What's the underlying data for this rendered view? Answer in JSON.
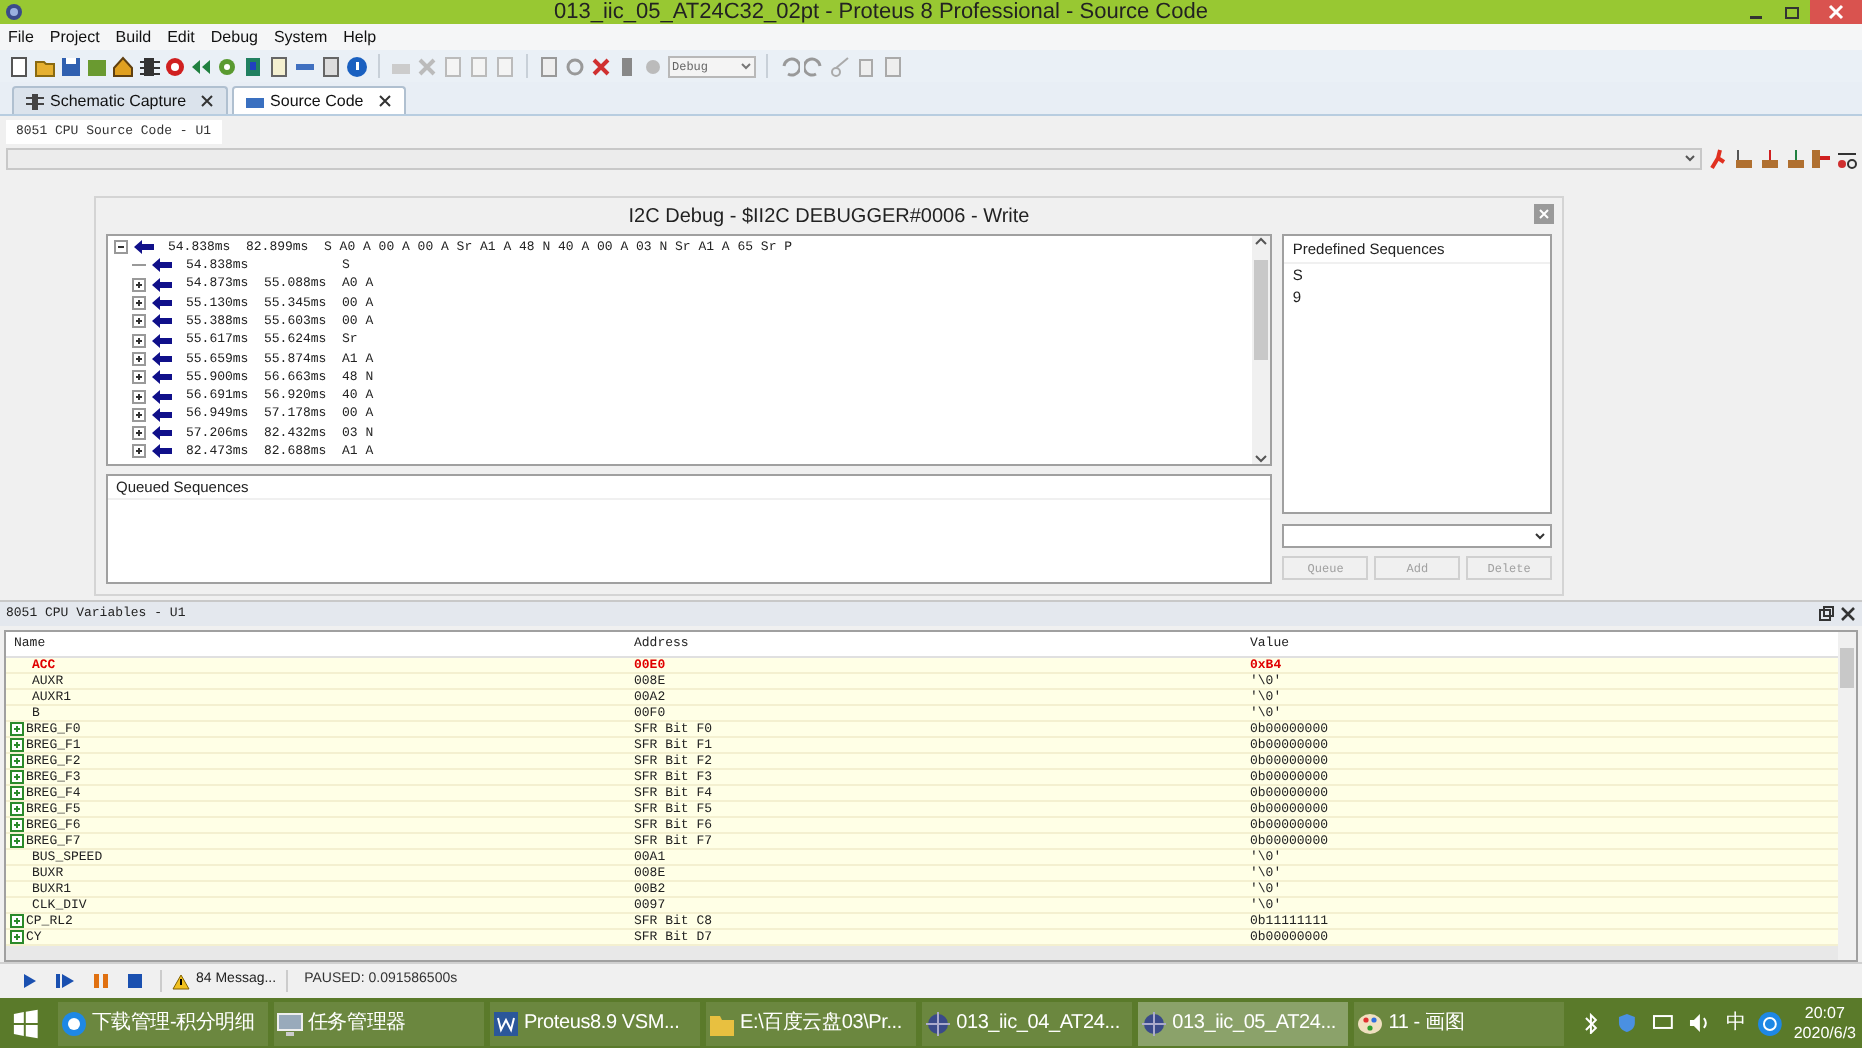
{
  "window": {
    "title": "013_iic_05_AT24C32_02pt - Proteus 8 Professional - Source Code"
  },
  "menu": [
    "File",
    "Project",
    "Build",
    "Edit",
    "Debug",
    "System",
    "Help"
  ],
  "toolbar": {
    "build_config": "Debug"
  },
  "tabs": [
    {
      "label": "Schematic Capture",
      "selected": false
    },
    {
      "label": "Source Code",
      "selected": true
    }
  ],
  "source_panel": {
    "title": "8051 CPU Source Code - U1"
  },
  "i2c_dialog": {
    "title": "I2C Debug - $II2C DEBUGGER#0006 - Write",
    "tree": {
      "expanded": true,
      "start": "54.838ms",
      "end": "82.899ms",
      "data": "S A0 A 00 A 00 A Sr A1 A 48 N 40 A 00 A 03 N Sr A1 A 65 Sr P",
      "children": [
        {
          "start": "54.838ms",
          "data": "S",
          "expandable": false
        },
        {
          "start": "54.873ms",
          "end": "55.088ms",
          "data": "A0 A",
          "expandable": true
        },
        {
          "start": "55.130ms",
          "end": "55.345ms",
          "data": "00 A",
          "expandable": true
        },
        {
          "start": "55.388ms",
          "end": "55.603ms",
          "data": "00 A",
          "expandable": true
        },
        {
          "start": "55.617ms",
          "end": "55.624ms",
          "data": "Sr",
          "expandable": true
        },
        {
          "start": "55.659ms",
          "end": "55.874ms",
          "data": "A1 A",
          "expandable": true
        },
        {
          "start": "55.900ms",
          "end": "56.663ms",
          "data": "48 N",
          "expandable": true
        },
        {
          "start": "56.691ms",
          "end": "56.920ms",
          "data": "40 A",
          "expandable": true
        },
        {
          "start": "56.949ms",
          "end": "57.178ms",
          "data": "00 A",
          "expandable": true
        },
        {
          "start": "57.206ms",
          "end": "82.432ms",
          "data": "03 N",
          "expandable": true
        },
        {
          "start": "82.473ms",
          "end": "82.688ms",
          "data": "A1 A",
          "expandable": true
        }
      ]
    },
    "queued_title": "Queued Sequences",
    "predefined": {
      "title": "Predefined Sequences",
      "items": [
        "S",
        "9"
      ]
    },
    "buttons": [
      {
        "label": "Queue",
        "disabled": true
      },
      {
        "label": "Add",
        "disabled": true
      },
      {
        "label": "Delete",
        "disabled": true
      }
    ]
  },
  "variables": {
    "title": "8051 CPU Variables - U1",
    "columns": [
      "Name",
      "Address",
      "Value"
    ],
    "rows": [
      {
        "name": "ACC",
        "address": "00E0",
        "value": "0xB4",
        "changed": true,
        "expandable": false
      },
      {
        "name": "AUXR",
        "address": "008E",
        "value": "'\\0'",
        "changed": false,
        "expandable": false
      },
      {
        "name": "AUXR1",
        "address": "00A2",
        "value": "'\\0'",
        "changed": false,
        "expandable": false
      },
      {
        "name": "B",
        "address": "00F0",
        "value": "'\\0'",
        "changed": false,
        "expandable": false
      },
      {
        "name": "BREG_F0",
        "address": "SFR Bit F0",
        "value": "0b00000000",
        "changed": false,
        "expandable": true
      },
      {
        "name": "BREG_F1",
        "address": "SFR Bit F1",
        "value": "0b00000000",
        "changed": false,
        "expandable": true
      },
      {
        "name": "BREG_F2",
        "address": "SFR Bit F2",
        "value": "0b00000000",
        "changed": false,
        "expandable": true
      },
      {
        "name": "BREG_F3",
        "address": "SFR Bit F3",
        "value": "0b00000000",
        "changed": false,
        "expandable": true
      },
      {
        "name": "BREG_F4",
        "address": "SFR Bit F4",
        "value": "0b00000000",
        "changed": false,
        "expandable": true
      },
      {
        "name": "BREG_F5",
        "address": "SFR Bit F5",
        "value": "0b00000000",
        "changed": false,
        "expandable": true
      },
      {
        "name": "BREG_F6",
        "address": "SFR Bit F6",
        "value": "0b00000000",
        "changed": false,
        "expandable": true
      },
      {
        "name": "BREG_F7",
        "address": "SFR Bit F7",
        "value": "0b00000000",
        "changed": false,
        "expandable": true
      },
      {
        "name": "BUS_SPEED",
        "address": "00A1",
        "value": "'\\0'",
        "changed": false,
        "expandable": false
      },
      {
        "name": "BUXR",
        "address": "008E",
        "value": "'\\0'",
        "changed": false,
        "expandable": false
      },
      {
        "name": "BUXR1",
        "address": "00B2",
        "value": "'\\0'",
        "changed": false,
        "expandable": false
      },
      {
        "name": "CLK_DIV",
        "address": "0097",
        "value": "'\\0'",
        "changed": false,
        "expandable": false
      },
      {
        "name": "CP_RL2",
        "address": "SFR Bit C8",
        "value": "0b11111111",
        "changed": false,
        "expandable": true
      },
      {
        "name": "CY",
        "address": "SFR Bit D7",
        "value": "0b00000000",
        "changed": false,
        "expandable": true
      }
    ]
  },
  "debug_bar": {
    "messages": "84 Messag...",
    "status": "PAUSED: 0.091586500s"
  },
  "taskbar": {
    "items": [
      {
        "label": "下载管理-积分明细",
        "kind": "browser",
        "selected": false
      },
      {
        "label": "任务管理器",
        "kind": "monitor",
        "selected": false
      },
      {
        "label": "Proteus8.9 VSM...",
        "kind": "word",
        "selected": false
      },
      {
        "label": "E:\\百度云盘03\\Pr...",
        "kind": "folder",
        "selected": false
      },
      {
        "label": "013_iic_04_AT24...",
        "kind": "proteus",
        "selected": false
      },
      {
        "label": "013_iic_05_AT24...",
        "kind": "proteus",
        "selected": true
      },
      {
        "label": "11 - 画图",
        "kind": "paint",
        "selected": false
      }
    ],
    "ime": "中",
    "time": "20:07",
    "date": "2020/6/3"
  }
}
